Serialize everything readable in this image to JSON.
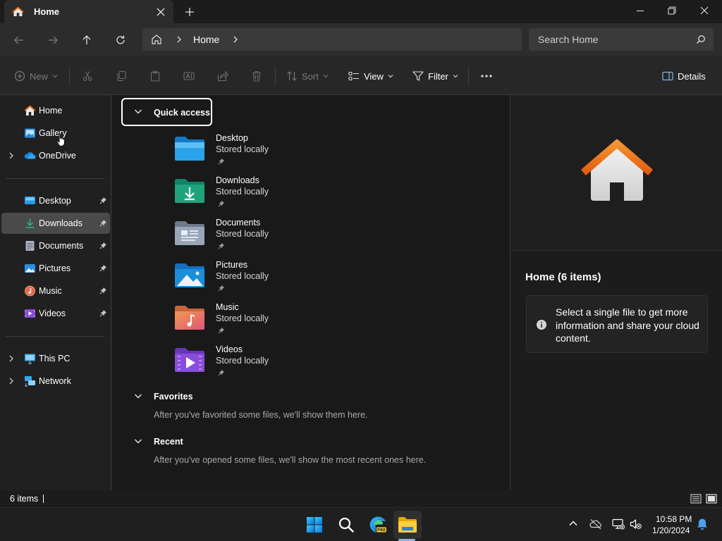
{
  "window": {
    "tab_title": "Home",
    "tab_icon": "home-icon",
    "controls": [
      "minimize-icon",
      "restore-icon",
      "close-icon"
    ]
  },
  "address_bar": {
    "path": [
      "Home"
    ],
    "search_placeholder": "Search Home"
  },
  "command_bar": {
    "new_label": "New",
    "sort_label": "Sort",
    "view_label": "View",
    "filter_label": "Filter",
    "details_label": "Details"
  },
  "sidebar": {
    "items": [
      {
        "label": "Home",
        "icon": "home-icon"
      },
      {
        "label": "Gallery",
        "icon": "gallery-icon"
      },
      {
        "label": "OneDrive",
        "icon": "onedrive-icon"
      },
      {
        "label": "Desktop",
        "icon": "desktop-icon",
        "pinned": true
      },
      {
        "label": "Downloads",
        "icon": "downloads-icon",
        "pinned": true,
        "selected": true
      },
      {
        "label": "Documents",
        "icon": "documents-icon",
        "pinned": true
      },
      {
        "label": "Pictures",
        "icon": "pictures-icon",
        "pinned": true
      },
      {
        "label": "Music",
        "icon": "music-icon",
        "pinned": true
      },
      {
        "label": "Videos",
        "icon": "videos-icon",
        "pinned": true
      },
      {
        "label": "This PC",
        "icon": "this-pc-icon"
      },
      {
        "label": "Network",
        "icon": "network-icon"
      }
    ]
  },
  "main": {
    "quick_access": {
      "label": "Quick access",
      "items": [
        {
          "name": "Desktop",
          "sub": "Stored locally",
          "icon": "desktop-folder-icon"
        },
        {
          "name": "Downloads",
          "sub": "Stored locally",
          "icon": "downloads-folder-icon"
        },
        {
          "name": "Documents",
          "sub": "Stored locally",
          "icon": "documents-folder-icon"
        },
        {
          "name": "Pictures",
          "sub": "Stored locally",
          "icon": "pictures-folder-icon"
        },
        {
          "name": "Music",
          "sub": "Stored locally",
          "icon": "music-folder-icon"
        },
        {
          "name": "Videos",
          "sub": "Stored locally",
          "icon": "videos-folder-icon"
        }
      ]
    },
    "favorites": {
      "label": "Favorites",
      "empty_text": "After you've favorited some files, we'll show them here."
    },
    "recent": {
      "label": "Recent",
      "empty_text": "After you've opened some files, we'll show the most recent ones here."
    }
  },
  "details_pane": {
    "title": "Home (6 items)",
    "info_text": "Select a single file to get more information and share your cloud content."
  },
  "status_bar": {
    "item_count": "6 items"
  },
  "taskbar": {
    "apps": [
      "start-icon",
      "search-icon",
      "edge-preview-icon",
      "file-explorer-icon"
    ],
    "time": "10:58 PM",
    "date": "1/20/2024"
  },
  "colors": {
    "accent_home": "#f0721a",
    "selected_bg": "#4a4a4a",
    "folder_blue": "#1b8fd8",
    "folder_green": "#1fa37c",
    "folder_purple": "#8a4ddb"
  }
}
